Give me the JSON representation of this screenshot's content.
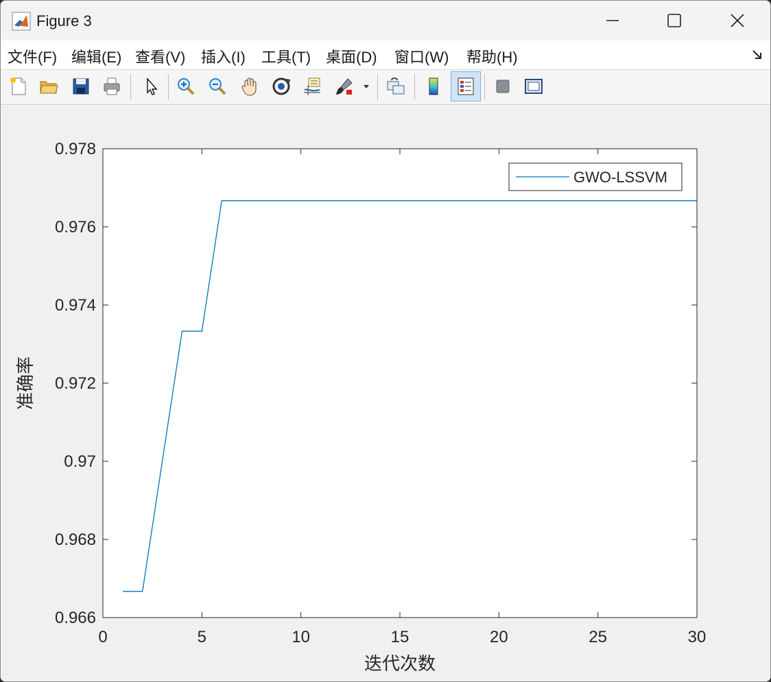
{
  "window": {
    "title": "Figure 3",
    "controls": [
      "minimize",
      "maximize",
      "close"
    ]
  },
  "menubar": {
    "items": [
      "文件(F)",
      "编辑(E)",
      "查看(V)",
      "插入(I)",
      "工具(T)",
      "桌面(D)",
      "窗口(W)",
      "帮助(H)"
    ]
  },
  "toolbar": {
    "buttons": [
      {
        "icon": "new-figure-icon"
      },
      {
        "icon": "open-file-icon"
      },
      {
        "icon": "save-icon"
      },
      {
        "icon": "print-icon"
      },
      {
        "icon": "edit-plot-arrow-icon"
      },
      {
        "icon": "zoom-in-icon"
      },
      {
        "icon": "zoom-out-icon"
      },
      {
        "icon": "pan-hand-icon"
      },
      {
        "icon": "rotate-3d-icon"
      },
      {
        "icon": "data-cursor-icon"
      },
      {
        "icon": "brush-icon"
      },
      {
        "icon": "link-plot-icon"
      },
      {
        "icon": "colorbar-icon"
      },
      {
        "icon": "legend-icon",
        "active": true
      },
      {
        "icon": "hide-plot-tools-icon"
      },
      {
        "icon": "show-plot-tools-icon"
      }
    ]
  },
  "chart_data": {
    "type": "line",
    "xlabel": "迭代次数",
    "ylabel": "准确率",
    "xlim": [
      0,
      30
    ],
    "ylim": [
      0.966,
      0.978
    ],
    "xticks": [
      "0",
      "5",
      "10",
      "15",
      "20",
      "25",
      "30"
    ],
    "yticks": [
      "0.966",
      "0.968",
      "0.97",
      "0.972",
      "0.974",
      "0.976",
      "0.978"
    ],
    "legend_position": "top-right",
    "series": [
      {
        "name": "GWO-LSSVM",
        "color": "#0072BD",
        "x": [
          1,
          2,
          3,
          4,
          5,
          6,
          7,
          8,
          9,
          10,
          11,
          12,
          13,
          14,
          15,
          16,
          17,
          18,
          19,
          20,
          21,
          22,
          23,
          24,
          25,
          26,
          27,
          28,
          29,
          30
        ],
        "y": [
          0.96667,
          0.96667,
          0.97,
          0.97333,
          0.97333,
          0.97667,
          0.97667,
          0.97667,
          0.97667,
          0.97667,
          0.97667,
          0.97667,
          0.97667,
          0.97667,
          0.97667,
          0.97667,
          0.97667,
          0.97667,
          0.97667,
          0.97667,
          0.97667,
          0.97667,
          0.97667,
          0.97667,
          0.97667,
          0.97667,
          0.97667,
          0.97667,
          0.97667,
          0.97667
        ]
      }
    ]
  }
}
